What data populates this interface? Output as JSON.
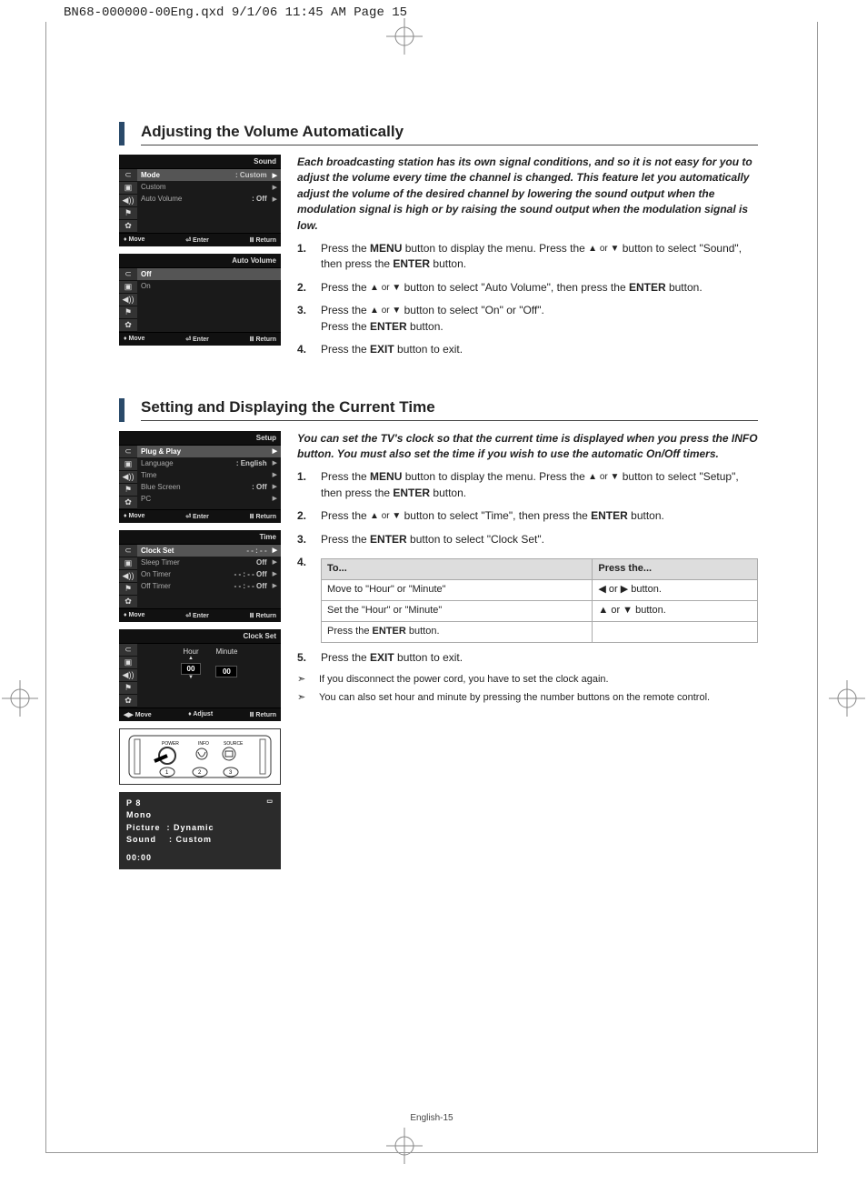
{
  "header": "BN68-000000-00Eng.qxd  9/1/06 11:45 AM  Page 15",
  "page_footer": "English-15",
  "section1": {
    "title": "Adjusting the Volume Automatically",
    "intro": "Each broadcasting station has its own signal conditions, and so it is not easy for you to adjust the volume every time the channel is changed. This feature let you automatically adjust the volume of the desired channel by lowering the sound output when the modulation signal is high or by raising the sound output when the modulation signal is low.",
    "steps": [
      {
        "n": "1.",
        "t_a": "Press the ",
        "b1": "MENU",
        "t_b": " button to display the menu. Press the ",
        "arr": "▲ or ▼",
        "t_c": " button to select \"Sound\", then press the ",
        "b2": "ENTER",
        "t_d": " button."
      },
      {
        "n": "2.",
        "t_a": "Press the ",
        "arr": "▲ or ▼",
        "t_b": " button to select \"Auto Volume\", then press the ",
        "b1": "ENTER",
        "t_c": " button."
      },
      {
        "n": "3.",
        "t_a": "Press the ",
        "arr": "▲ or ▼",
        "t_b": " button to select \"On\" or \"Off\".",
        "br": true,
        "t_c": "Press the ",
        "b1": "ENTER",
        "t_d": " button."
      },
      {
        "n": "4.",
        "t_a": "Press the ",
        "b1": "EXIT",
        "t_b": " button to exit."
      }
    ],
    "osd1": {
      "title": "Sound",
      "rows": [
        {
          "label": "Mode",
          "val": ": Custom",
          "hl": true
        },
        {
          "label": "Custom",
          "val": "",
          "hl": false
        },
        {
          "label": "Auto Volume",
          "val": ": Off",
          "hl": false
        }
      ],
      "footer": {
        "l": "Move",
        "m": "Enter",
        "r": "Return"
      }
    },
    "osd2": {
      "title": "Auto Volume",
      "rows": [
        {
          "label": "Off",
          "val": "",
          "hl": true
        },
        {
          "label": "On",
          "val": "",
          "hl": false
        }
      ],
      "footer": {
        "l": "Move",
        "m": "Enter",
        "r": "Return"
      }
    }
  },
  "section2": {
    "title": "Setting and Displaying the Current Time",
    "intro": "You can set the TV's clock so that the current time is displayed when you press the INFO button. You must also set the time if you wish to use the automatic On/Off timers.",
    "steps": [
      {
        "n": "1.",
        "t_a": "Press the ",
        "b1": "MENU",
        "t_b": " button to display the menu. Press the ",
        "arr": "▲ or ▼",
        "t_c": " button to select \"Setup\", then press the ",
        "b2": "ENTER",
        "t_d": " button."
      },
      {
        "n": "2.",
        "t_a": "Press the ",
        "arr": "▲ or ▼",
        "t_b": " button to select \"Time\", then press the ",
        "b1": "ENTER",
        "t_c": " button."
      },
      {
        "n": "3.",
        "t_a": "Press the ",
        "b1": "ENTER",
        "t_b": " button to select \"Clock Set\"."
      },
      {
        "n": "4."
      },
      {
        "n": "5.",
        "t_a": "Press the ",
        "b1": "EXIT",
        "t_b": " button to exit."
      }
    ],
    "table": {
      "h1": "To...",
      "h2": "Press the...",
      "rows": [
        {
          "c1": "Move to \"Hour\" or \"Minute\"",
          "c2": "◀  or  ▶  button."
        },
        {
          "c1": "Set the \"Hour\" or \"Minute\"",
          "c2": "▲  or  ▼  button."
        },
        {
          "c1_a": "Press the ",
          "b": "ENTER",
          "c1_b": " button.",
          "c2": ""
        }
      ]
    },
    "notes": [
      "If you disconnect the power cord, you have to set the clock again.",
      "You can also set hour and minute by pressing the number buttons on the remote control."
    ],
    "osd1": {
      "title": "Setup",
      "rows": [
        {
          "label": "Plug & Play",
          "val": "",
          "hl": true
        },
        {
          "label": "Language",
          "val": ": English",
          "hl": false
        },
        {
          "label": "Time",
          "val": "",
          "hl": false
        },
        {
          "label": "Blue Screen",
          "val": ": Off",
          "hl": false
        },
        {
          "label": "PC",
          "val": "",
          "hl": false
        }
      ],
      "footer": {
        "l": "Move",
        "m": "Enter",
        "r": "Return"
      }
    },
    "osd2": {
      "title": "Time",
      "rows": [
        {
          "label": "Clock Set",
          "val": "- - : - -",
          "hl": true
        },
        {
          "label": "Sleep Timer",
          "val": "Off",
          "hl": false
        },
        {
          "label": "On Timer",
          "val": "- - : - -    Off",
          "hl": false
        },
        {
          "label": "Off Timer",
          "val": "- - : - -    Off",
          "hl": false
        }
      ],
      "footer": {
        "l": "Move",
        "m": "Enter",
        "r": "Return"
      }
    },
    "osd3": {
      "title": "Clock Set",
      "hour_label": "Hour",
      "min_label": "Minute",
      "hour": "00",
      "min": "00",
      "footer": {
        "l": "Move",
        "m": "Adjust",
        "r": "Return"
      }
    },
    "remote": {
      "power": "POWER",
      "info": "INFO",
      "source": "SOURCE",
      "nums": "1   2   3"
    },
    "infobox": {
      "p": "P 8",
      "mono": "Mono",
      "pic_l": "Picture",
      "pic_v": ": Dynamic",
      "snd_l": "Sound",
      "snd_v": ": Custom",
      "time": "00:00"
    }
  }
}
